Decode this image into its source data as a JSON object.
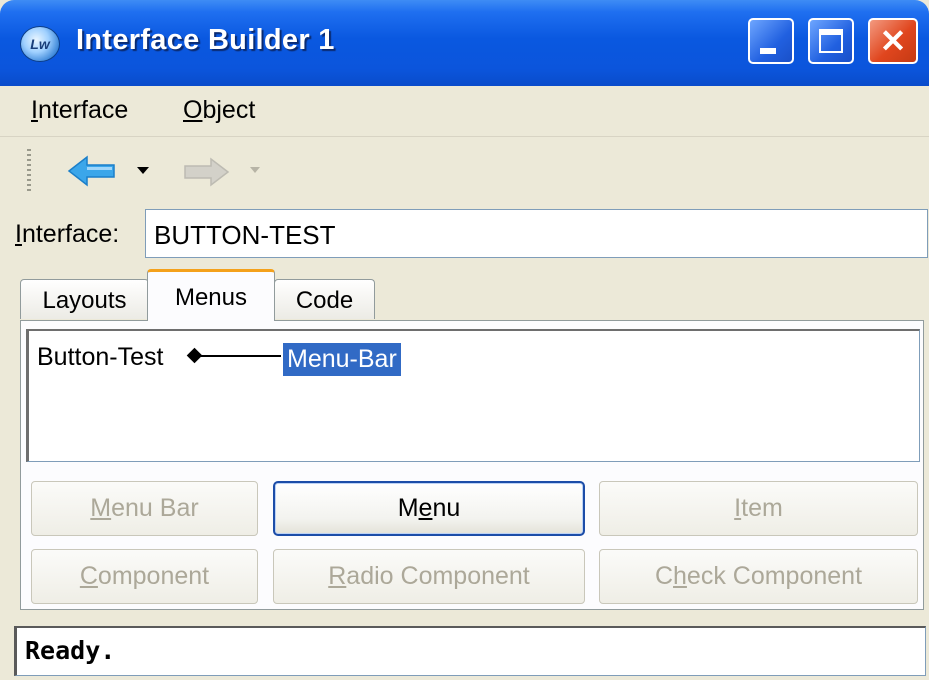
{
  "window": {
    "title": "Interface Builder 1",
    "app_icon_text": "Lw",
    "minimize_icon": "minimize-icon",
    "maximize_icon": "maximize-icon",
    "close_icon": "close-icon",
    "close_glyph": "✕"
  },
  "menubar": {
    "interface": {
      "accel": "I",
      "rest": "nterface"
    },
    "object": {
      "accel": "O",
      "rest": "bject"
    }
  },
  "toolbar": {
    "back_icon": "back-arrow-icon",
    "forward_icon": "forward-arrow-icon",
    "back_enabled": true,
    "forward_enabled": false,
    "colors": {
      "back": "#3ba6ea",
      "forward_disabled": "#c9c7bf"
    }
  },
  "interface_field": {
    "label_accel": "I",
    "label_rest": "nterface:",
    "value": "BUTTON-TEST"
  },
  "tabs": {
    "items": [
      {
        "label": "Layouts",
        "selected": false
      },
      {
        "label": "Menus",
        "selected": true
      },
      {
        "label": "Code",
        "selected": false
      }
    ]
  },
  "tree": {
    "root": "Button-Test",
    "child": "Menu-Bar",
    "child_selected": true
  },
  "buttons": {
    "menu_bar": {
      "pre": "",
      "accel": "M",
      "post": "enu Bar",
      "enabled": false
    },
    "menu": {
      "pre": "M",
      "accel": "e",
      "post": "nu",
      "enabled": true
    },
    "item": {
      "pre": "",
      "accel": "I",
      "post": "tem",
      "enabled": false
    },
    "component": {
      "pre": "",
      "accel": "C",
      "post": "omponent",
      "enabled": false
    },
    "radio_component": {
      "pre": "",
      "accel": "R",
      "post": "adio Component",
      "enabled": false
    },
    "check_component": {
      "pre": "C",
      "accel": "h",
      "post": "eck Component",
      "enabled": false
    }
  },
  "status": {
    "text": "Ready."
  },
  "colors": {
    "titlebar": "#0a58e0",
    "selection": "#316ac5",
    "tab_accent": "#f4a11b",
    "disabled_text": "#aca899"
  }
}
